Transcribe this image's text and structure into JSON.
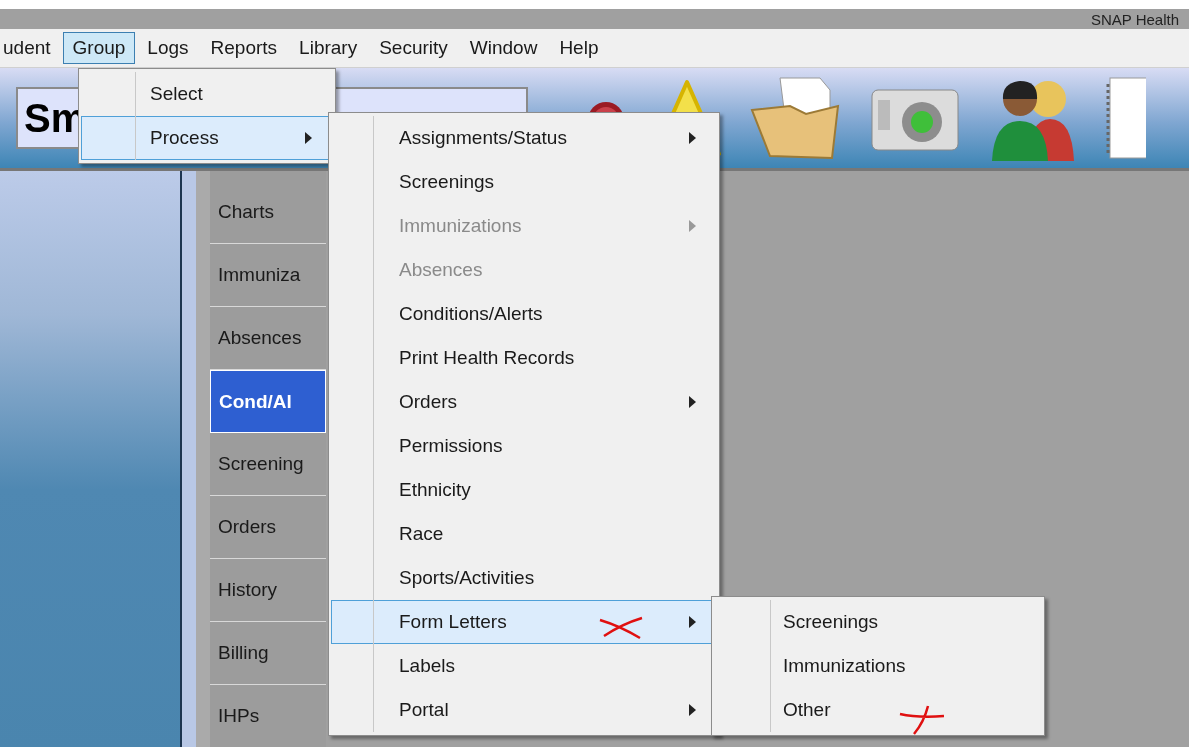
{
  "window": {
    "title": "SNAP Health"
  },
  "menubar": [
    {
      "label": "udent",
      "selected": false
    },
    {
      "label": "Group",
      "selected": true
    },
    {
      "label": "Logs",
      "selected": false
    },
    {
      "label": "Reports",
      "selected": false
    },
    {
      "label": "Library",
      "selected": false
    },
    {
      "label": "Security",
      "selected": false
    },
    {
      "label": "Window",
      "selected": false
    },
    {
      "label": "Help",
      "selected": false
    }
  ],
  "search": {
    "value": "Sm"
  },
  "tabs": [
    {
      "label": "Charts",
      "selected": false
    },
    {
      "label": "Immuniza",
      "selected": false
    },
    {
      "label": "Absences",
      "selected": false
    },
    {
      "label": "Cond/Al",
      "selected": true
    },
    {
      "label": "Screening",
      "selected": false
    },
    {
      "label": "Orders",
      "selected": false
    },
    {
      "label": "History",
      "selected": false
    },
    {
      "label": "Billing",
      "selected": false
    },
    {
      "label": "IHPs",
      "selected": false
    }
  ],
  "group_menu": [
    {
      "label": "Select",
      "selected": false,
      "submenu": false
    },
    {
      "label": "Process",
      "selected": true,
      "submenu": true
    }
  ],
  "process_menu": [
    {
      "label": "Assignments/Status",
      "selected": false,
      "submenu": true,
      "disabled": false
    },
    {
      "label": "Screenings",
      "selected": false,
      "submenu": false,
      "disabled": false
    },
    {
      "label": "Immunizations",
      "selected": false,
      "submenu": true,
      "disabled": true
    },
    {
      "label": "Absences",
      "selected": false,
      "submenu": false,
      "disabled": true
    },
    {
      "label": "Conditions/Alerts",
      "selected": false,
      "submenu": false,
      "disabled": false
    },
    {
      "label": "Print Health Records",
      "selected": false,
      "submenu": false,
      "disabled": false
    },
    {
      "label": "Orders",
      "selected": false,
      "submenu": true,
      "disabled": false
    },
    {
      "label": "Permissions",
      "selected": false,
      "submenu": false,
      "disabled": false
    },
    {
      "label": "Ethnicity",
      "selected": false,
      "submenu": false,
      "disabled": false
    },
    {
      "label": "Race",
      "selected": false,
      "submenu": false,
      "disabled": false
    },
    {
      "label": "Sports/Activities",
      "selected": false,
      "submenu": false,
      "disabled": false
    },
    {
      "label": "Form Letters",
      "selected": true,
      "submenu": true,
      "disabled": false
    },
    {
      "label": "Labels",
      "selected": false,
      "submenu": false,
      "disabled": false
    },
    {
      "label": "Portal",
      "selected": false,
      "submenu": true,
      "disabled": false
    }
  ],
  "form_letters_menu": [
    {
      "label": "Screenings",
      "selected": false
    },
    {
      "label": "Immunizations",
      "selected": false
    },
    {
      "label": "Other",
      "selected": false
    }
  ]
}
